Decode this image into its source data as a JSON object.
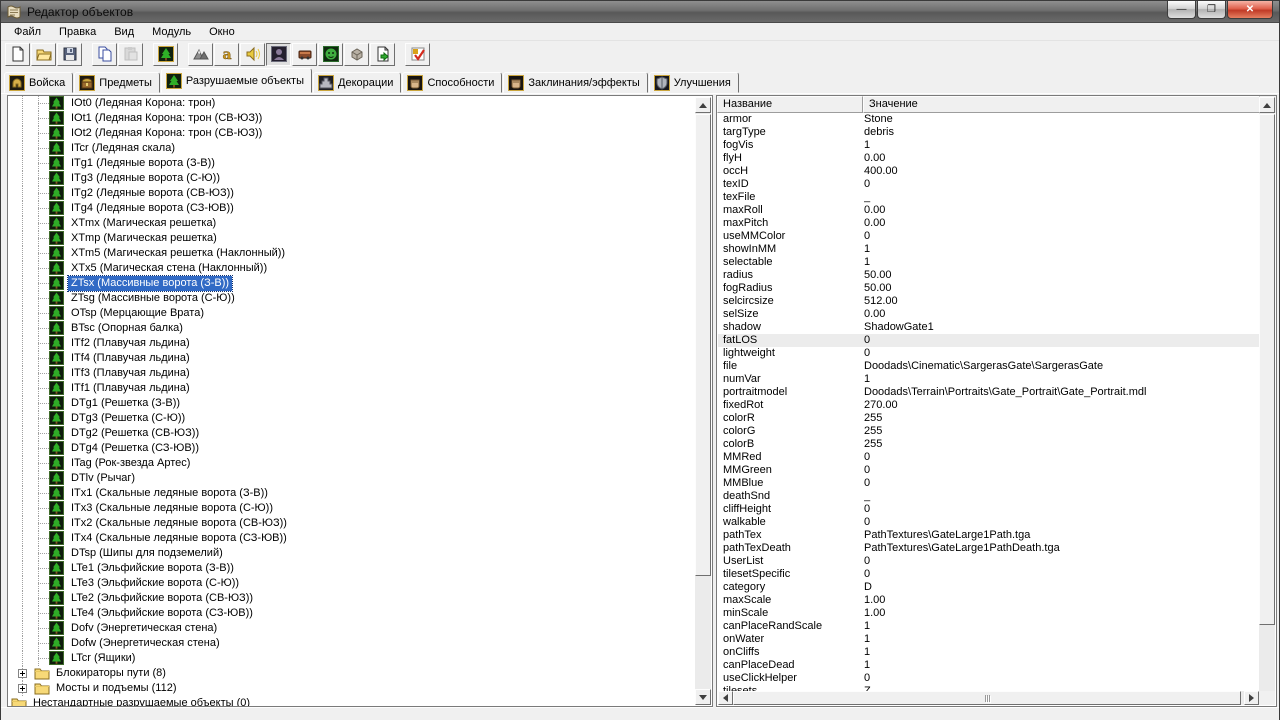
{
  "window": {
    "title": "Редактор объектов",
    "controls": {
      "minimize_glyph": "—",
      "restore_glyph": "❐",
      "close_glyph": "✕"
    }
  },
  "menu_bar": {
    "items": [
      {
        "name": "file",
        "label": "Файл"
      },
      {
        "name": "edit",
        "label": "Правка"
      },
      {
        "name": "view",
        "label": "Вид"
      },
      {
        "name": "module",
        "label": "Модуль"
      },
      {
        "name": "window",
        "label": "Окно"
      }
    ]
  },
  "toolbar": {
    "buttons": [
      {
        "name": "new-map",
        "icon": "new"
      },
      {
        "name": "open-map",
        "icon": "open"
      },
      {
        "name": "save-map",
        "icon": "save"
      },
      {
        "name": "copy",
        "icon": "copy",
        "group_start": true
      },
      {
        "name": "paste",
        "icon": "paste",
        "disabled": true
      },
      {
        "name": "terrain-editor",
        "icon": "tree",
        "group_start": true
      },
      {
        "name": "terrain-palette",
        "icon": "mountain",
        "group_start": true
      },
      {
        "name": "trigger-editor",
        "icon": "letter-a"
      },
      {
        "name": "sound-editor",
        "icon": "speaker"
      },
      {
        "name": "object-editor",
        "icon": "unit",
        "pressed": true
      },
      {
        "name": "campaign-editor",
        "icon": "campaign"
      },
      {
        "name": "ai-editor",
        "icon": "ai-face"
      },
      {
        "name": "object-manager",
        "icon": "box"
      },
      {
        "name": "import-manager",
        "icon": "import"
      },
      {
        "name": "test-map",
        "icon": "test",
        "group_start": true
      }
    ]
  },
  "tabs": [
    {
      "name": "units",
      "icon": "helmet",
      "label": "Войска"
    },
    {
      "name": "items",
      "icon": "chest",
      "label": "Предметы"
    },
    {
      "name": "destructibles",
      "icon": "tree",
      "label": "Разрушаемые объекты",
      "active": true
    },
    {
      "name": "doodads",
      "icon": "ziggurat",
      "label": "Декорации"
    },
    {
      "name": "abilities",
      "icon": "fist",
      "label": "Способности"
    },
    {
      "name": "buffs",
      "icon": "fist",
      "label": "Заклинания/эффекты"
    },
    {
      "name": "upgrades",
      "icon": "shield",
      "label": "Улучшения"
    }
  ],
  "tree": {
    "items": [
      {
        "type": "object",
        "label": "IOt0 (Ледяная Корона: трон)"
      },
      {
        "type": "object",
        "label": "IOt1 (Ледяная Корона: трон (СВ-ЮЗ))"
      },
      {
        "type": "object",
        "label": "IOt2 (Ледяная Корона: трон (СВ-ЮЗ))"
      },
      {
        "type": "object",
        "label": "ITcr (Ледяная скала)"
      },
      {
        "type": "object",
        "label": "ITg1 (Ледяные ворота (З-В))"
      },
      {
        "type": "object",
        "label": "ITg3 (Ледяные ворота (С-Ю))"
      },
      {
        "type": "object",
        "label": "ITg2 (Ледяные ворота (СВ-ЮЗ))"
      },
      {
        "type": "object",
        "label": "ITg4 (Ледяные ворота (СЗ-ЮВ))"
      },
      {
        "type": "object",
        "label": "XTmx (Магическая решетка)"
      },
      {
        "type": "object",
        "label": "XTmp (Магическая решетка)"
      },
      {
        "type": "object",
        "label": "XTm5 (Магическая решетка (Наклонный))"
      },
      {
        "type": "object",
        "label": "XTx5 (Магическая стена (Наклонный))"
      },
      {
        "type": "object",
        "label": "ZTsx (Массивные ворота (З-В))",
        "selected": true
      },
      {
        "type": "object",
        "label": "ZTsg (Массивные ворота (С-Ю))"
      },
      {
        "type": "object",
        "label": "OTsp (Мерцающие Врата)"
      },
      {
        "type": "object",
        "label": "BTsc (Опорная балка)"
      },
      {
        "type": "object",
        "label": "ITf2 (Плавучая льдина)"
      },
      {
        "type": "object",
        "label": "ITf4 (Плавучая льдина)"
      },
      {
        "type": "object",
        "label": "ITf3 (Плавучая льдина)"
      },
      {
        "type": "object",
        "label": "ITf1 (Плавучая льдина)"
      },
      {
        "type": "object",
        "label": "DTg1 (Решетка (З-В))"
      },
      {
        "type": "object",
        "label": "DTg3 (Решетка (С-Ю))"
      },
      {
        "type": "object",
        "label": "DTg2 (Решетка (СВ-ЮЗ))"
      },
      {
        "type": "object",
        "label": "DTg4 (Решетка (СЗ-ЮВ))"
      },
      {
        "type": "object",
        "label": "ITag (Рок-звезда Артес)"
      },
      {
        "type": "object",
        "label": "DTlv (Рычаг)"
      },
      {
        "type": "object",
        "label": "ITx1 (Скальные ледяные ворота (З-В))"
      },
      {
        "type": "object",
        "label": "ITx3 (Скальные ледяные ворота (С-Ю))"
      },
      {
        "type": "object",
        "label": "ITx2 (Скальные ледяные ворота (СВ-ЮЗ))"
      },
      {
        "type": "object",
        "label": "ITx4 (Скальные ледяные ворота (СЗ-ЮВ))"
      },
      {
        "type": "object",
        "label": "DTsp (Шипы для подземелий)"
      },
      {
        "type": "object",
        "label": "LTe1 (Эльфийские ворота (З-В))"
      },
      {
        "type": "object",
        "label": "LTe3 (Эльфийские ворота (С-Ю))"
      },
      {
        "type": "object",
        "label": "LTe2 (Эльфийские ворота (СВ-ЮЗ))"
      },
      {
        "type": "object",
        "label": "LTe4 (Эльфийские ворота (СЗ-ЮВ))"
      },
      {
        "type": "object",
        "label": "Dofv (Энергетическая стена)"
      },
      {
        "type": "object",
        "label": "Dofw (Энергетическая стена)"
      },
      {
        "type": "object",
        "label": "LTcr (Ящики)"
      },
      {
        "type": "folder",
        "level": 1,
        "expandable": true,
        "label": "Блокираторы пути (8)"
      },
      {
        "type": "folder",
        "level": 1,
        "expandable": true,
        "label": "Мосты и подъемы (112)"
      },
      {
        "type": "folder",
        "level": 0,
        "label": "Нестандартные разрушаемые объекты (0)"
      }
    ]
  },
  "properties": {
    "columns": [
      "Название",
      "Значение"
    ],
    "rows": [
      {
        "name": "armor",
        "value": "Stone"
      },
      {
        "name": "targType",
        "value": "debris"
      },
      {
        "name": "fogVis",
        "value": "1"
      },
      {
        "name": "flyH",
        "value": "0.00"
      },
      {
        "name": "occH",
        "value": "400.00"
      },
      {
        "name": "texID",
        "value": "0"
      },
      {
        "name": "texFile",
        "value": "_"
      },
      {
        "name": "maxRoll",
        "value": "0.00"
      },
      {
        "name": "maxPitch",
        "value": "0.00"
      },
      {
        "name": "useMMColor",
        "value": "0"
      },
      {
        "name": "showInMM",
        "value": "1"
      },
      {
        "name": "selectable",
        "value": "1"
      },
      {
        "name": "radius",
        "value": "50.00"
      },
      {
        "name": "fogRadius",
        "value": "50.00"
      },
      {
        "name": "selcircsize",
        "value": "512.00"
      },
      {
        "name": "selSize",
        "value": "0.00"
      },
      {
        "name": "shadow",
        "value": "ShadowGate1"
      },
      {
        "name": "fatLOS",
        "value": "0",
        "highlighted": true
      },
      {
        "name": "lightweight",
        "value": "0"
      },
      {
        "name": "file",
        "value": "Doodads\\Cinematic\\SargerasGate\\SargerasGate"
      },
      {
        "name": "numVar",
        "value": "1"
      },
      {
        "name": "portraitmodel",
        "value": "Doodads\\Terrain\\Portraits\\Gate_Portrait\\Gate_Portrait.mdl"
      },
      {
        "name": "fixedRot",
        "value": "270.00"
      },
      {
        "name": "colorR",
        "value": "255"
      },
      {
        "name": "colorG",
        "value": "255"
      },
      {
        "name": "colorB",
        "value": "255"
      },
      {
        "name": "MMRed",
        "value": "0"
      },
      {
        "name": "MMGreen",
        "value": "0"
      },
      {
        "name": "MMBlue",
        "value": "0"
      },
      {
        "name": "deathSnd",
        "value": "_"
      },
      {
        "name": "cliffHeight",
        "value": "0"
      },
      {
        "name": "walkable",
        "value": "0"
      },
      {
        "name": "pathTex",
        "value": "PathTextures\\GateLarge1Path.tga"
      },
      {
        "name": "pathTexDeath",
        "value": "PathTextures\\GateLarge1PathDeath.tga"
      },
      {
        "name": "UserList",
        "value": "0"
      },
      {
        "name": "tilesetSpecific",
        "value": "0"
      },
      {
        "name": "category",
        "value": "D"
      },
      {
        "name": "maxScale",
        "value": "1.00"
      },
      {
        "name": "minScale",
        "value": "1.00"
      },
      {
        "name": "canPlaceRandScale",
        "value": "1"
      },
      {
        "name": "onWater",
        "value": "1"
      },
      {
        "name": "onCliffs",
        "value": "1"
      },
      {
        "name": "canPlaceDead",
        "value": "1"
      },
      {
        "name": "useClickHelper",
        "value": "0"
      },
      {
        "name": "tilesets",
        "value": "Z",
        "clipped": true
      }
    ]
  },
  "colors": {
    "selection": "#316ac5",
    "selection_text": "#ffffff",
    "highlight_row": "#ececec",
    "chrome": "#f0f0f0",
    "titlebar": "#6e6e6e",
    "close_button": "#c03a26"
  }
}
